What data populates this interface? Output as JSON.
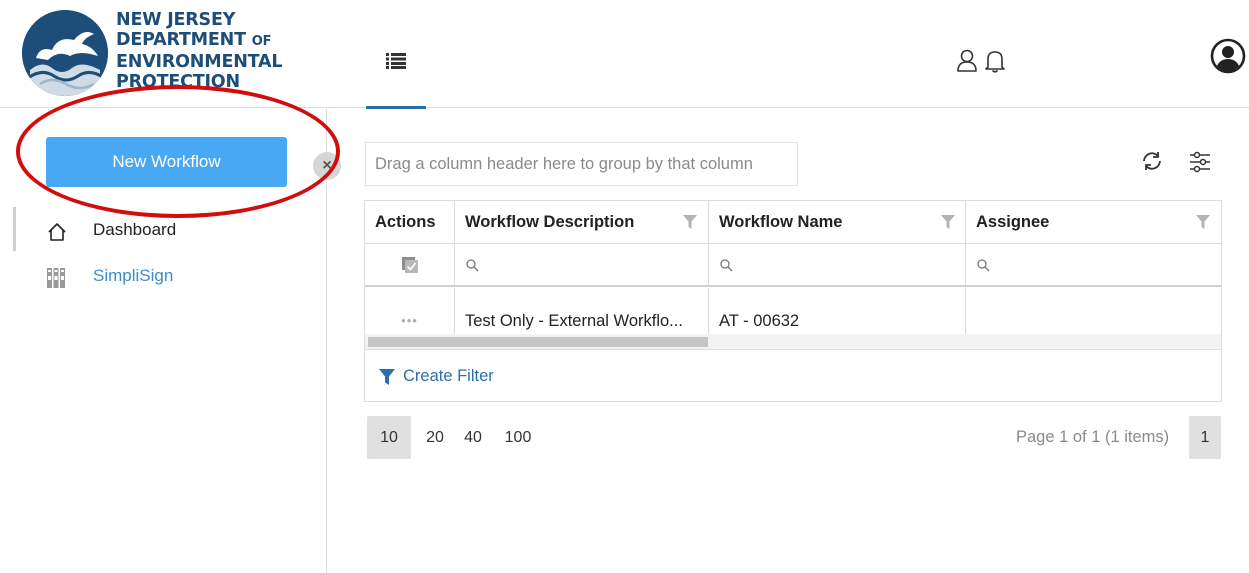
{
  "header": {
    "logo": {
      "line1": "NEW JERSEY",
      "line2": "DEPARTMENT",
      "line2_small": "OF",
      "line3": "ENVIRONMENTAL",
      "line4": "PROTECTION"
    },
    "icons": [
      "menu-list-icon",
      "user-icon",
      "bell-icon",
      "avatar-icon"
    ]
  },
  "sidebar": {
    "new_workflow_label": "New Workflow",
    "collapse_label": "×",
    "items": [
      {
        "label": "Dashboard",
        "icon": "home-icon"
      },
      {
        "label": "SimpliSign",
        "icon": "simplisign-icon"
      }
    ]
  },
  "main": {
    "group_panel_text": "Drag a column header here to group by that column",
    "toolbar_icons": [
      "refresh-icon",
      "column-settings-icon"
    ],
    "grid": {
      "columns": [
        "Actions",
        "Workflow Description",
        "Workflow Name",
        "Assignee"
      ],
      "rows": [
        {
          "actions": "•••",
          "description": "Test Only - External Workflo...",
          "name": "AT - 00632",
          "assignee": ""
        }
      ],
      "create_filter_label": "Create Filter"
    },
    "pager": {
      "sizes": [
        "10",
        "20",
        "40",
        "100"
      ],
      "selected_size": "10",
      "info": "Page 1 of 1 (1 items)",
      "current_page": "1"
    }
  },
  "colors": {
    "brand": "#1d4e79",
    "primary_button": "#49a8f4",
    "link": "#2d6fa8",
    "annotation": "#d10d0d"
  }
}
